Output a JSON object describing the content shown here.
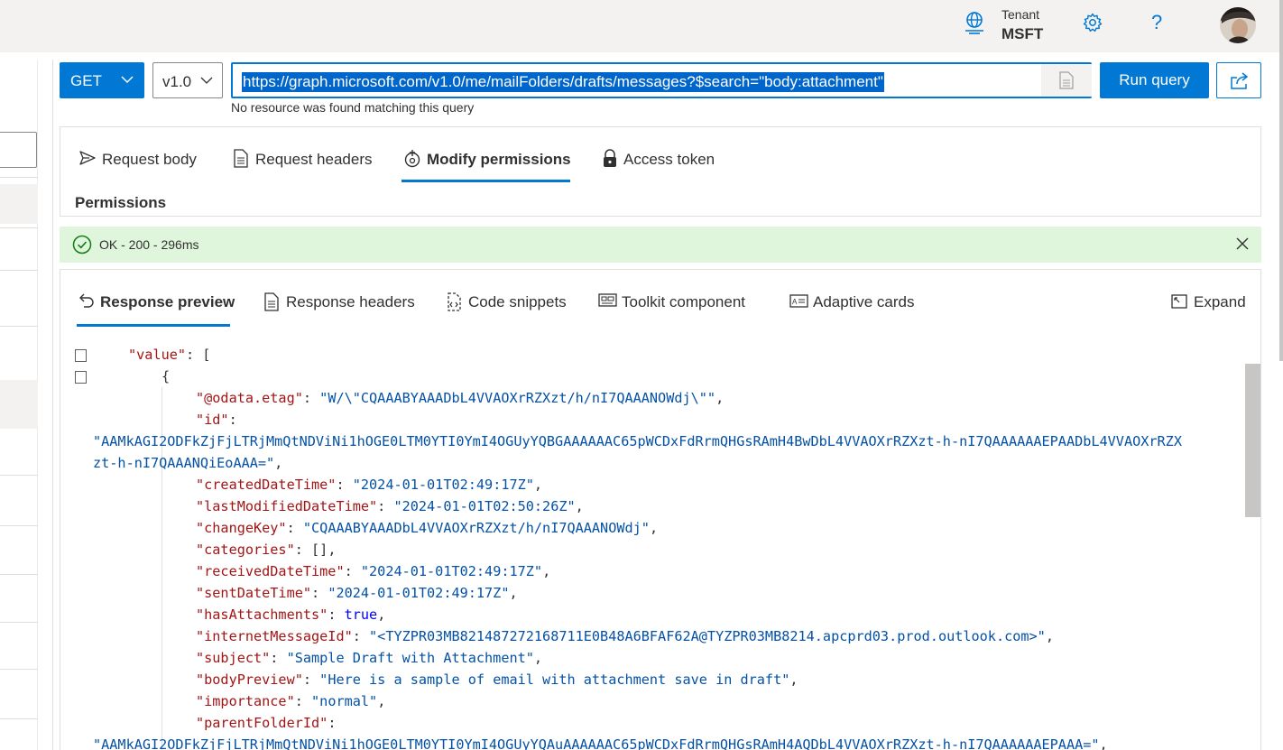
{
  "header": {
    "tenant_label": "Tenant",
    "tenant_name": "MSFT",
    "help_label": "?",
    "icons": [
      "tenant-icon",
      "settings-gear-icon",
      "help-icon",
      "user-avatar"
    ]
  },
  "query": {
    "method": "GET",
    "version": "v1.0",
    "url": "https://graph.microsoft.com/v1.0/me/mailFolders/drafts/messages?$search=\"body:attachment\"",
    "run_label": "Run query",
    "hint": "No resource was found matching this query"
  },
  "request_tabs": [
    {
      "label": "Request body",
      "icon": "send-icon"
    },
    {
      "label": "Request headers",
      "icon": "document-icon"
    },
    {
      "label": "Modify permissions",
      "icon": "permission-icon",
      "active": true
    },
    {
      "label": "Access token",
      "icon": "lock-icon"
    }
  ],
  "permissions_label": "Permissions",
  "status": {
    "text": "OK - 200 - 296ms",
    "color": "#dff6dd"
  },
  "response_tabs": [
    {
      "label": "Response preview",
      "icon": "undo-icon",
      "active": true
    },
    {
      "label": "Response headers",
      "icon": "document-icon"
    },
    {
      "label": "Code snippets",
      "icon": "code-icon"
    },
    {
      "label": "Toolkit component",
      "icon": "toolkit-icon"
    },
    {
      "label": "Adaptive cards",
      "icon": "card-icon"
    }
  ],
  "expand_label": "Expand",
  "code": {
    "l0_key": "\"value\"",
    "l0_rest": ": [",
    "l1": "{",
    "l2_key": "\"@odata.etag\"",
    "l2_val": "\"W/\\\"CQAAABYAAADbL4VVAOXrRZXzt/h/nI7QAAANOWdj\\\"\"",
    "l3_key": "\"id\"",
    "l4": "\"AAMkAGI2ODFkZjFjLTRjMmQtNDViNi1hOGE0LTM0YTI0YmI4OGUyYQBGAAAAAAC65pWCDxFdRrmQHGsRAmH4BwDbL4VVAOXrRZXzt-h-nI7QAAAAAAEPAADbL4VVAOXrRZX",
    "l5": "zt-h-nI7QAAANQiEoAAA=\"",
    "l6_key": "\"createdDateTime\"",
    "l6_val": "\"2024-01-01T02:49:17Z\"",
    "l7_key": "\"lastModifiedDateTime\"",
    "l7_val": "\"2024-01-01T02:50:26Z\"",
    "l8_key": "\"changeKey\"",
    "l8_val": "\"CQAAABYAAADbL4VVAOXrRZXzt/h/nI7QAAANOWdj\"",
    "l9_key": "\"categories\"",
    "l9_val": "[]",
    "l10_key": "\"receivedDateTime\"",
    "l10_val": "\"2024-01-01T02:49:17Z\"",
    "l11_key": "\"sentDateTime\"",
    "l11_val": "\"2024-01-01T02:49:17Z\"",
    "l12_key": "\"hasAttachments\"",
    "l12_val": "true",
    "l13_key": "\"internetMessageId\"",
    "l13_val": "\"<TYZPR03MB821487272168711E0B48A6BFAF62A@TYZPR03MB8214.apcprd03.prod.outlook.com>\"",
    "l14_key": "\"subject\"",
    "l14_val": "\"Sample Draft with Attachment\"",
    "l15_key": "\"bodyPreview\"",
    "l15_val": "\"Here is a sample of email with attachment save in draft\"",
    "l16_key": "\"importance\"",
    "l16_val": "\"normal\"",
    "l17_key": "\"parentFolderId\"",
    "l18": "\"AAMkAGI2ODFkZjFjLTRjMmQtNDViNi1hOGE0LTM0YTI0YmI4OGUyYQAuAAAAAAC65pWCDxFdRrmQHGsRAmH4AQDbL4VVAOXrRZXzt-h-nI7QAAAAAAEPAAA=\""
  }
}
